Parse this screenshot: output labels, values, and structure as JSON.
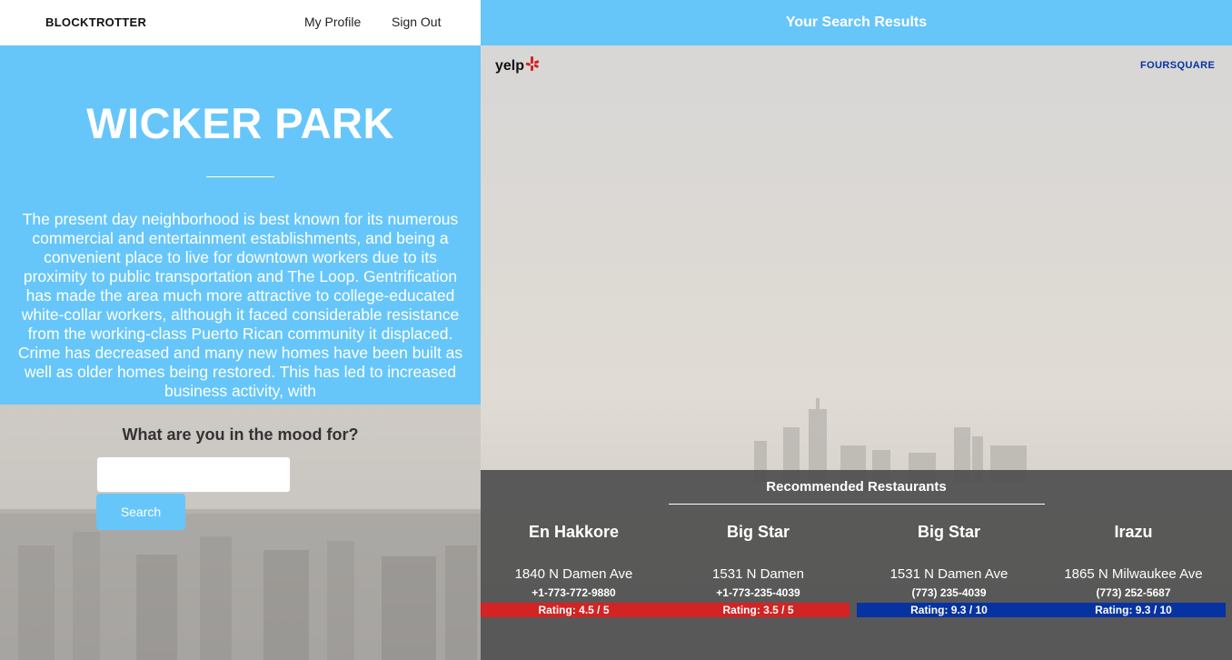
{
  "nav": {
    "brand": "BLOCKTROTTER",
    "my_profile": "My Profile",
    "sign_out": "Sign Out"
  },
  "results_header": "Your Search Results",
  "neighborhood": {
    "name": "WICKER PARK",
    "description": "The present day neighborhood is best known for its numerous commercial and entertainment establishments, and being a convenient place to live for downtown workers due to its proximity to public transportation and The Loop. Gentrification has made the area much more attractive to college-educated white-collar workers, although it faced considerable resistance from the working-class Puerto Rican community it displaced. Crime has decreased and many new homes have been built as well as older homes being restored. This has led to increased business activity, with"
  },
  "search": {
    "prompt": "What are you in the mood for?",
    "input_value": "",
    "button_label": "Search"
  },
  "logos": {
    "yelp": "yelp",
    "foursquare": "FOURSQUARE"
  },
  "recommended": {
    "title": "Recommended Restaurants",
    "restaurants": [
      {
        "name": "En Hakkore",
        "address": "1840 N Damen Ave",
        "phone": "+1-773-772-9880",
        "rating": "Rating: 4.5 / 5",
        "source": "yelp"
      },
      {
        "name": "Big Star",
        "address": "1531 N Damen",
        "phone": "+1-773-235-4039",
        "rating": "Rating: 3.5 / 5",
        "source": "yelp"
      },
      {
        "name": "Big Star",
        "address": "1531 N Damen Ave",
        "phone": "(773) 235-4039",
        "rating": "Rating: 9.3 / 10",
        "source": "foursquare"
      },
      {
        "name": "Irazu",
        "address": "1865 N Milwaukee Ave",
        "phone": "(773) 252-5687",
        "rating": "Rating: 9.3 / 10",
        "source": "foursquare"
      }
    ]
  },
  "colors": {
    "accent": "#66c6fa",
    "yelp_red": "#d32323",
    "foursquare_blue": "#0732a2"
  }
}
